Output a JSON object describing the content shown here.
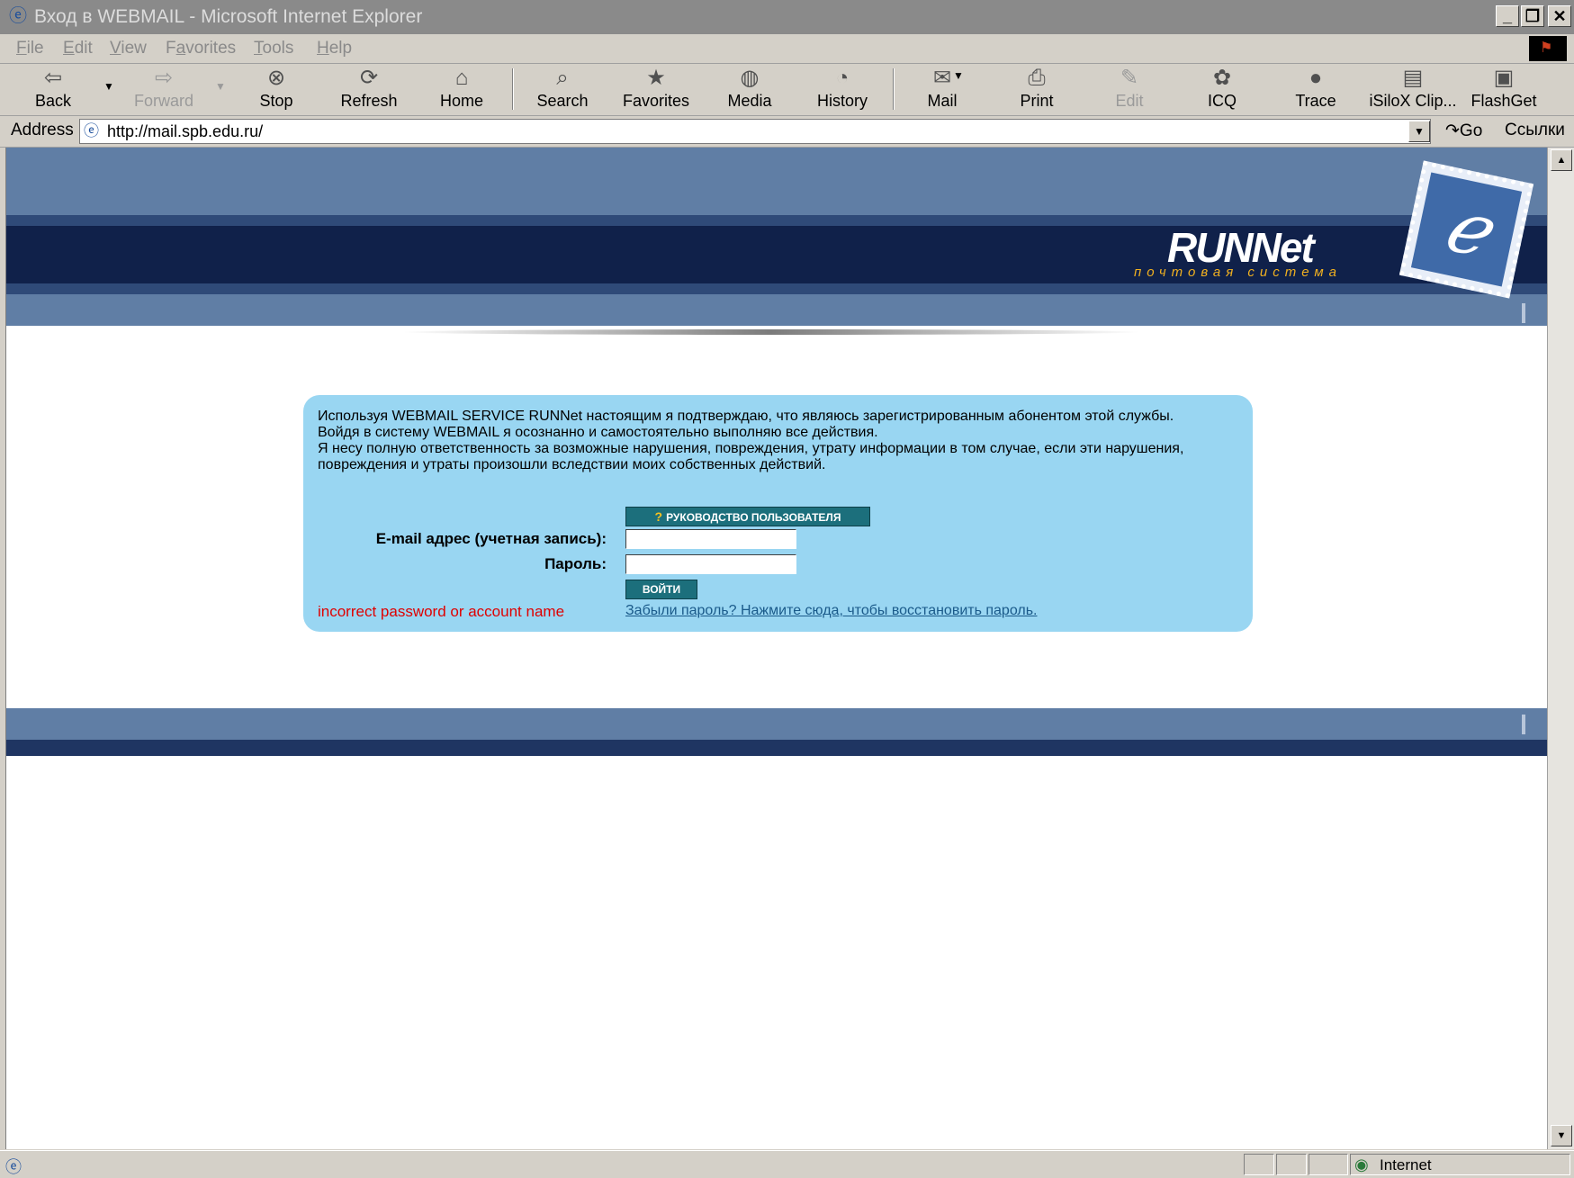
{
  "window": {
    "title": "Вход в WEBMAIL - Microsoft Internet Explorer",
    "controls": {
      "minimize": "_",
      "restore": "❐",
      "close": "✕"
    }
  },
  "menu": [
    {
      "label": "File",
      "hotkey": "F",
      "rest": "ile"
    },
    {
      "label": "Edit",
      "hotkey": "E",
      "rest": "dit"
    },
    {
      "label": "View",
      "hotkey": "V",
      "rest": "iew"
    },
    {
      "label": "Favorites",
      "hotkey": "a",
      "pre": "F",
      "rest": "vorites"
    },
    {
      "label": "Tools",
      "hotkey": "T",
      "rest": "ools"
    },
    {
      "label": "Help",
      "hotkey": "H",
      "rest": "elp"
    }
  ],
  "toolbar": {
    "back": "Back",
    "forward": "Forward",
    "stop": "Stop",
    "refresh": "Refresh",
    "home": "Home",
    "search": "Search",
    "favorites": "Favorites",
    "media": "Media",
    "history": "History",
    "mail": "Mail",
    "print": "Print",
    "edit": "Edit",
    "icq": "ICQ",
    "trace": "Trace",
    "isilox": "iSiloX Clip...",
    "flashget": "FlashGet"
  },
  "address": {
    "label": "Address",
    "url": "http://mail.spb.edu.ru/",
    "go": "Go",
    "links": "Ссылки"
  },
  "page": {
    "brand": "RUNNet",
    "tagline": "почтовая система",
    "notice": [
      "Используя WEBMAIL SERVICE RUNNet настоящим я подтверждаю, что являюсь зарегистрированным абонентом этой службы.",
      "Войдя в систему WEBMAIL я осознанно и самостоятельно выполняю все действия.",
      "Я несу полную ответственность за возможные нарушения, повреждения, утрату информации в том случае, если эти нарушения, повреждения и утраты произошли вследствии моих собственных действий."
    ],
    "guide_button": "РУКОВОДСТВО ПОЛЬЗОВАТЕЛЯ",
    "email_label": "E-mail адрес (учетная запись):",
    "email_value": "",
    "password_label": "Пароль:",
    "password_value": "",
    "login_button": "ВОЙТИ",
    "error": "incorrect password or account name",
    "forgot_link": "Забыли пароль? Нажмите сюда, чтобы восстановить пароль."
  },
  "status": {
    "zone": "Internet"
  },
  "colors": {
    "header_mid": "#607ea5",
    "header_dark": "#10214a",
    "login_box": "#99d6f2",
    "button": "#1c6f7c",
    "error": "#e00000",
    "tagline": "#f0b020"
  }
}
